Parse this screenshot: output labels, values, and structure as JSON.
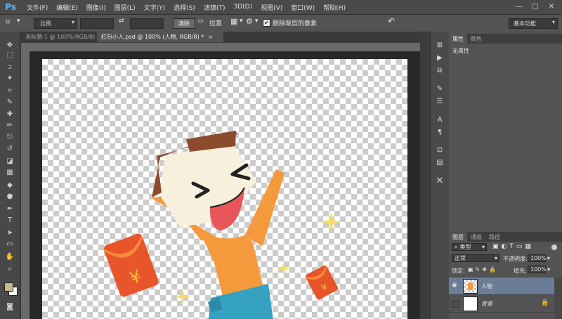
{
  "app": {
    "logo": "Ps"
  },
  "menu": [
    "文件(F)",
    "编辑(E)",
    "图像(I)",
    "图层(L)",
    "文字(Y)",
    "选择(S)",
    "滤镜(T)",
    "3D(D)",
    "视图(V)",
    "窗口(W)",
    "帮助(H)"
  ],
  "window_controls": {
    "minimize": "—",
    "maximize": "□",
    "close": "✕"
  },
  "options": {
    "crop_tool_icon": "crop-icon",
    "ratio_value": "比例",
    "clear_label": "清除",
    "straighten_label": "拉直",
    "delete_cropped_label": "删除裁剪的像素",
    "delete_cropped_checked": true,
    "workspace": "基本功能"
  },
  "tabs": [
    {
      "label": "未标题-1 @ 100%(RGB/8)",
      "active": false
    },
    {
      "label": "红包小人.psd @ 100% (人物, RGB/8) *",
      "active": true,
      "close": "×"
    }
  ],
  "tools": [
    "move-icon",
    "marquee-icon",
    "lasso-icon",
    "magic-wand-icon",
    "crop-icon",
    "eyedropper-icon",
    "healing-brush-icon",
    "brush-icon",
    "clone-stamp-icon",
    "history-brush-icon",
    "eraser-icon",
    "gradient-icon",
    "blur-icon",
    "dodge-icon",
    "pen-icon",
    "type-icon",
    "path-select-icon",
    "shape-icon",
    "hand-icon",
    "zoom-icon"
  ],
  "tool_glyphs": [
    "✥",
    "⬚",
    "ↄ",
    "✦",
    "⌗",
    "✎",
    "✚",
    "✏",
    "⎋",
    "↺",
    "◪",
    "▦",
    "◆",
    "●",
    "✒",
    "T",
    "➤",
    "▭",
    "✋",
    "⌕"
  ],
  "colors": {
    "foreground": "#c8b78a",
    "background": "#ffffff",
    "accent": "#6b7c96"
  },
  "properties_panel": {
    "tabs": [
      "属性",
      "颜色"
    ],
    "content": "无属性"
  },
  "layers_panel": {
    "tabs": [
      "图层",
      "通道",
      "路径"
    ],
    "filter_kind": "类型",
    "blend_mode": "正常",
    "opacity_label": "不透明度:",
    "opacity_value": "100%",
    "lock_label": "锁定:",
    "fill_label": "填充:",
    "fill_value": "100%",
    "layers": [
      {
        "name": "人物",
        "selected": true,
        "visible": true
      },
      {
        "name": "背景",
        "selected": false,
        "visible": false,
        "locked": true
      }
    ]
  }
}
